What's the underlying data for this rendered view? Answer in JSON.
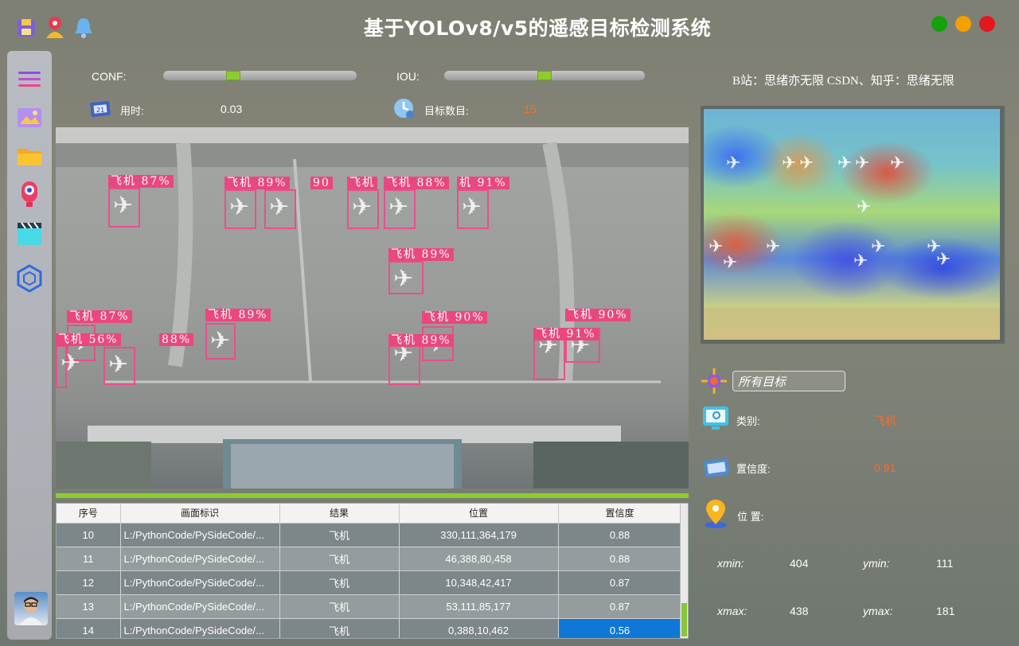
{
  "window": {
    "title": "基于YOLOv8/v5的遥感目标检测系统",
    "controls": {
      "close_color": "#e1191d",
      "minimize_color": "#f5a000",
      "maximize_color": "#13a10e"
    }
  },
  "top_icons": [
    "save-icon",
    "user-icon",
    "bell-icon"
  ],
  "sidebar": {
    "items": [
      "menu-icon",
      "image-icon",
      "folder-icon",
      "camera-icon",
      "video-icon",
      "model-icon"
    ],
    "avatar": "avatar"
  },
  "controls": {
    "conf_label": "CONF:",
    "conf_value": 0.35,
    "iou_label": "IOU:",
    "iou_value": 0.5,
    "time_label": "用时:",
    "time_value": "0.03",
    "count_label": "目标数目:",
    "count_value": "15",
    "credit": "B站：思绪亦无限  CSDN、知乎：思绪无限"
  },
  "detections": [
    {
      "label": "飞机 87%"
    },
    {
      "label": "飞机 89%"
    },
    {
      "label": "90"
    },
    {
      "label": "飞机"
    },
    {
      "label": "飞机 88%"
    },
    {
      "label": "机 91%"
    },
    {
      "label": "飞机 89%"
    },
    {
      "label": "飞机 87%"
    },
    {
      "label": "飞机 89%"
    },
    {
      "label": "飞机 90%"
    },
    {
      "label": "飞机 90%"
    },
    {
      "label": "飞机 56%"
    },
    {
      "label": "88%"
    },
    {
      "label": "飞机 89%"
    },
    {
      "label": "飞机 91%"
    }
  ],
  "info": {
    "filter_value": "所有目标",
    "class_label": "类别:",
    "class_value": "飞机",
    "conf_label": "置信度:",
    "conf_value": "0.91",
    "pos_label": "位 置:",
    "xmin_label": "xmin:",
    "xmin_value": "404",
    "ymin_label": "ymin:",
    "ymin_value": "111",
    "xmax_label": "xmax:",
    "xmax_value": "438",
    "ymax_label": "ymax:",
    "ymax_value": "181"
  },
  "table": {
    "headers": [
      "序号",
      "画面标识",
      "结果",
      "位置",
      "置信度"
    ],
    "rows": [
      [
        "10",
        "L:/PythonCode/PySideCode/...",
        "飞机",
        "330,111,364,179",
        "0.88"
      ],
      [
        "11",
        "L:/PythonCode/PySideCode/...",
        "飞机",
        "46,388,80,458",
        "0.88"
      ],
      [
        "12",
        "L:/PythonCode/PySideCode/...",
        "飞机",
        "10,348,42,417",
        "0.87"
      ],
      [
        "13",
        "L:/PythonCode/PySideCode/...",
        "飞机",
        "53,111,85,177",
        "0.87"
      ],
      [
        "14",
        "L:/PythonCode/PySideCode/...",
        "飞机",
        "0,388,10,462",
        "0.56"
      ]
    ],
    "selected_row": 4
  },
  "colors": {
    "accent": "#8ccd2d",
    "detection": "#e8487f",
    "highlight": "#ff6a2c",
    "selection": "#0f78d7"
  }
}
